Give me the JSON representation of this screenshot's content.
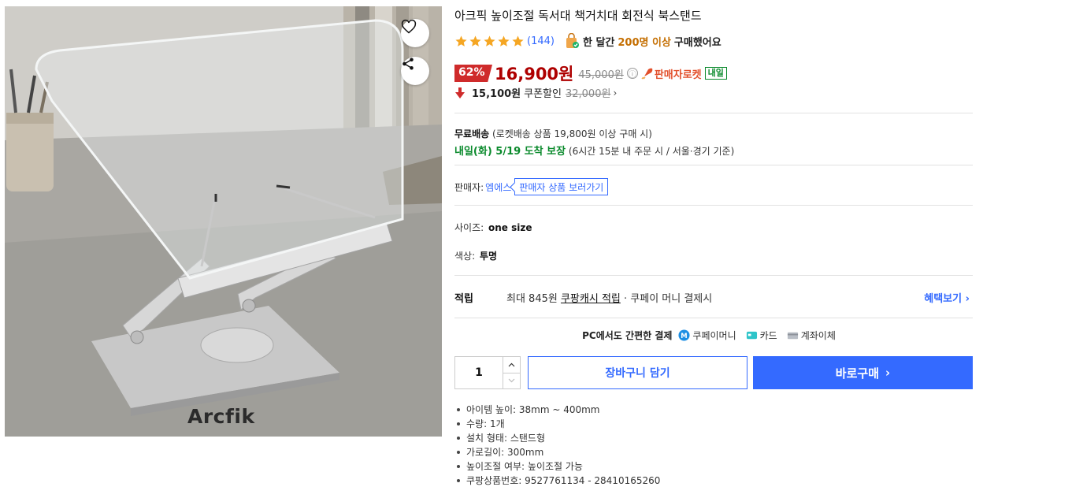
{
  "gallery": {
    "brand_text": "Arcfik",
    "wish_icon": "heart-outline-icon",
    "share_icon": "share-icon"
  },
  "product": {
    "title": "아크픽 높이조절 독서대 책거치대 회전식 북스탠드",
    "rating": {
      "stars": 5,
      "review_count": "(144)"
    },
    "buyers": {
      "prefix": "한 달간",
      "highlight": "200명 이상",
      "suffix": "구매했어요"
    }
  },
  "price": {
    "discount": "62%",
    "sale": "16,900원",
    "original": "45,000원",
    "info_icon": "ⓘ",
    "rocket_label": "판매자로켓",
    "tomorrow_badge": "내일",
    "coupon_price": "15,100원",
    "coupon_label": "쿠폰할인",
    "coupon_original": "32,000원",
    "coupon_chevron": "›",
    "colors": {
      "sale": "#ae0000",
      "badge": "#cf2b2b",
      "accent": "#346aff",
      "green": "#0a8a2c"
    }
  },
  "shipping": {
    "label": "무료배송",
    "detail": "(로켓배송 상품 19,800원 이상 구매 시)",
    "arrival_highlight": "내일(화) 5/19 도착 보장",
    "arrival_detail": "(6시간 15분 내 주문 시 / 서울⋅경기 기준)"
  },
  "seller": {
    "label": "판매자:",
    "name": "엠에스",
    "more_button": "판매자 상품 보러가기"
  },
  "options": {
    "size_label": "사이즈:",
    "size_value": "one size",
    "color_label": "색상:",
    "color_value": "투명"
  },
  "cash": {
    "label": "적립",
    "prefix": "최대 845원",
    "link": "쿠팡캐시 적립",
    "suffix": "· 쿠페이 머니 결제시",
    "benefit_link": "혜택보기 ›"
  },
  "payment": {
    "title": "PC에서도 간편한 결제",
    "methods": [
      "쿠페이머니",
      "카드",
      "계좌이체"
    ]
  },
  "purchase": {
    "quantity": "1",
    "cart_button": "장바구니 담기",
    "buy_button": "바로구매",
    "buy_chevron": "›"
  },
  "specs": [
    "아이템 높이: 38mm ~ 400mm",
    "수량: 1개",
    "설치 형태: 스탠드형",
    "가로길이: 300mm",
    "높이조절 여부: 높이조절 가능",
    "쿠팡상품번호: 9527761134 - 28410165260"
  ]
}
